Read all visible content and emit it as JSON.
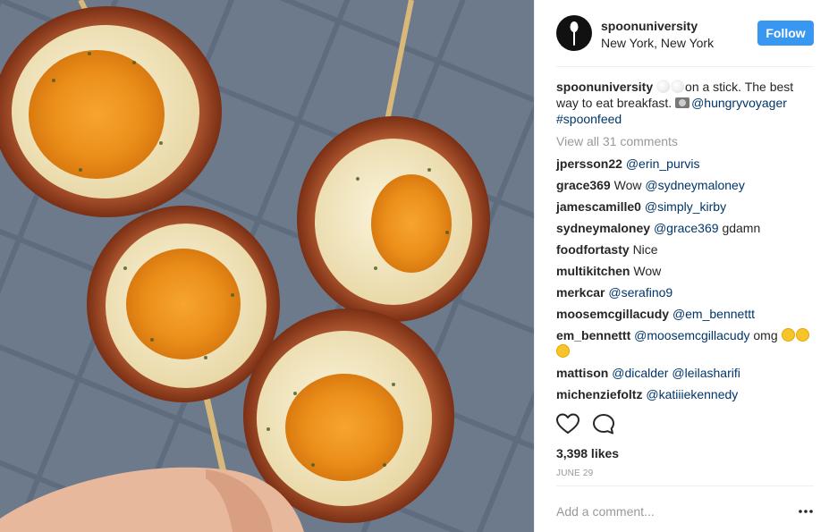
{
  "post": {
    "username": "spoonuniversity",
    "location": "New York, New York",
    "follow_label": "Follow"
  },
  "caption": {
    "username": "spoonuniversity",
    "text": "on a stick. The best way to eat breakfast.",
    "mention": "@hungryvoyager",
    "hashtag": "#spoonfeed"
  },
  "view_all": "View all 31 comments",
  "comments": [
    {
      "user": "jpersson22",
      "text": "@erin_purvis"
    },
    {
      "user": "grace369",
      "prefix": "Wow",
      "text": "@sydneymaloney"
    },
    {
      "user": "jamescamille0",
      "text": "@simply_kirby"
    },
    {
      "user": "sydneymaloney",
      "text": "@grace369",
      "suffix": "gdamn"
    },
    {
      "user": "foodfortasty",
      "text": "Nice"
    },
    {
      "user": "multikitchen",
      "text": "Wow"
    },
    {
      "user": "merkcar",
      "text": "@serafino9"
    },
    {
      "user": "moosemcgillacudy",
      "text": "@em_bennettt"
    },
    {
      "user": "em_bennettt",
      "text": "@moosemcgillacudy",
      "suffix": "omg"
    },
    {
      "user": "mattison",
      "text": "@dicalder",
      "text2": "@leilasharifi"
    },
    {
      "user": "michenziefoltz",
      "text": "@katiiiekennedy"
    }
  ],
  "likes": "3,398 likes",
  "date": "JUNE 29",
  "add_comment_placeholder": "Add a comment...",
  "icons": {
    "like": "heart-icon",
    "comment": "comment-icon",
    "more": "more-options-icon",
    "avatar": "spoon-logo"
  },
  "colors": {
    "follow": "#3897f0",
    "mention": "#003569",
    "muted": "#999999"
  }
}
